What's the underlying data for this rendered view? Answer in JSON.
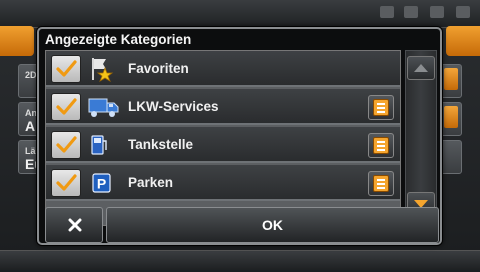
{
  "dialog": {
    "title": "Angezeigte Kategorien",
    "ok_label": "OK",
    "close_icon": "close-icon",
    "items": [
      {
        "label": "Favoriten",
        "checked": true,
        "icon": "favorites-flag-star-icon",
        "has_list_button": false
      },
      {
        "label": "LKW-Services",
        "checked": true,
        "icon": "truck-icon",
        "has_list_button": true
      },
      {
        "label": "Tankstelle",
        "checked": true,
        "icon": "fuel-pump-icon",
        "has_list_button": true
      },
      {
        "label": "Parken",
        "checked": true,
        "icon": "parking-icon",
        "has_list_button": true
      }
    ],
    "scroll_up_icon": "arrow-up-icon",
    "scroll_down_icon": "arrow-down-icon"
  },
  "colors": {
    "accent": "#f5a52e",
    "check": "#f09a12",
    "dialog_bg": "#0c0d0e",
    "row_bg": "#34373a"
  },
  "background": {
    "card_labels": [
      "2D",
      "An",
      "Lä"
    ],
    "card_values": [
      "Au",
      "Eu"
    ]
  }
}
